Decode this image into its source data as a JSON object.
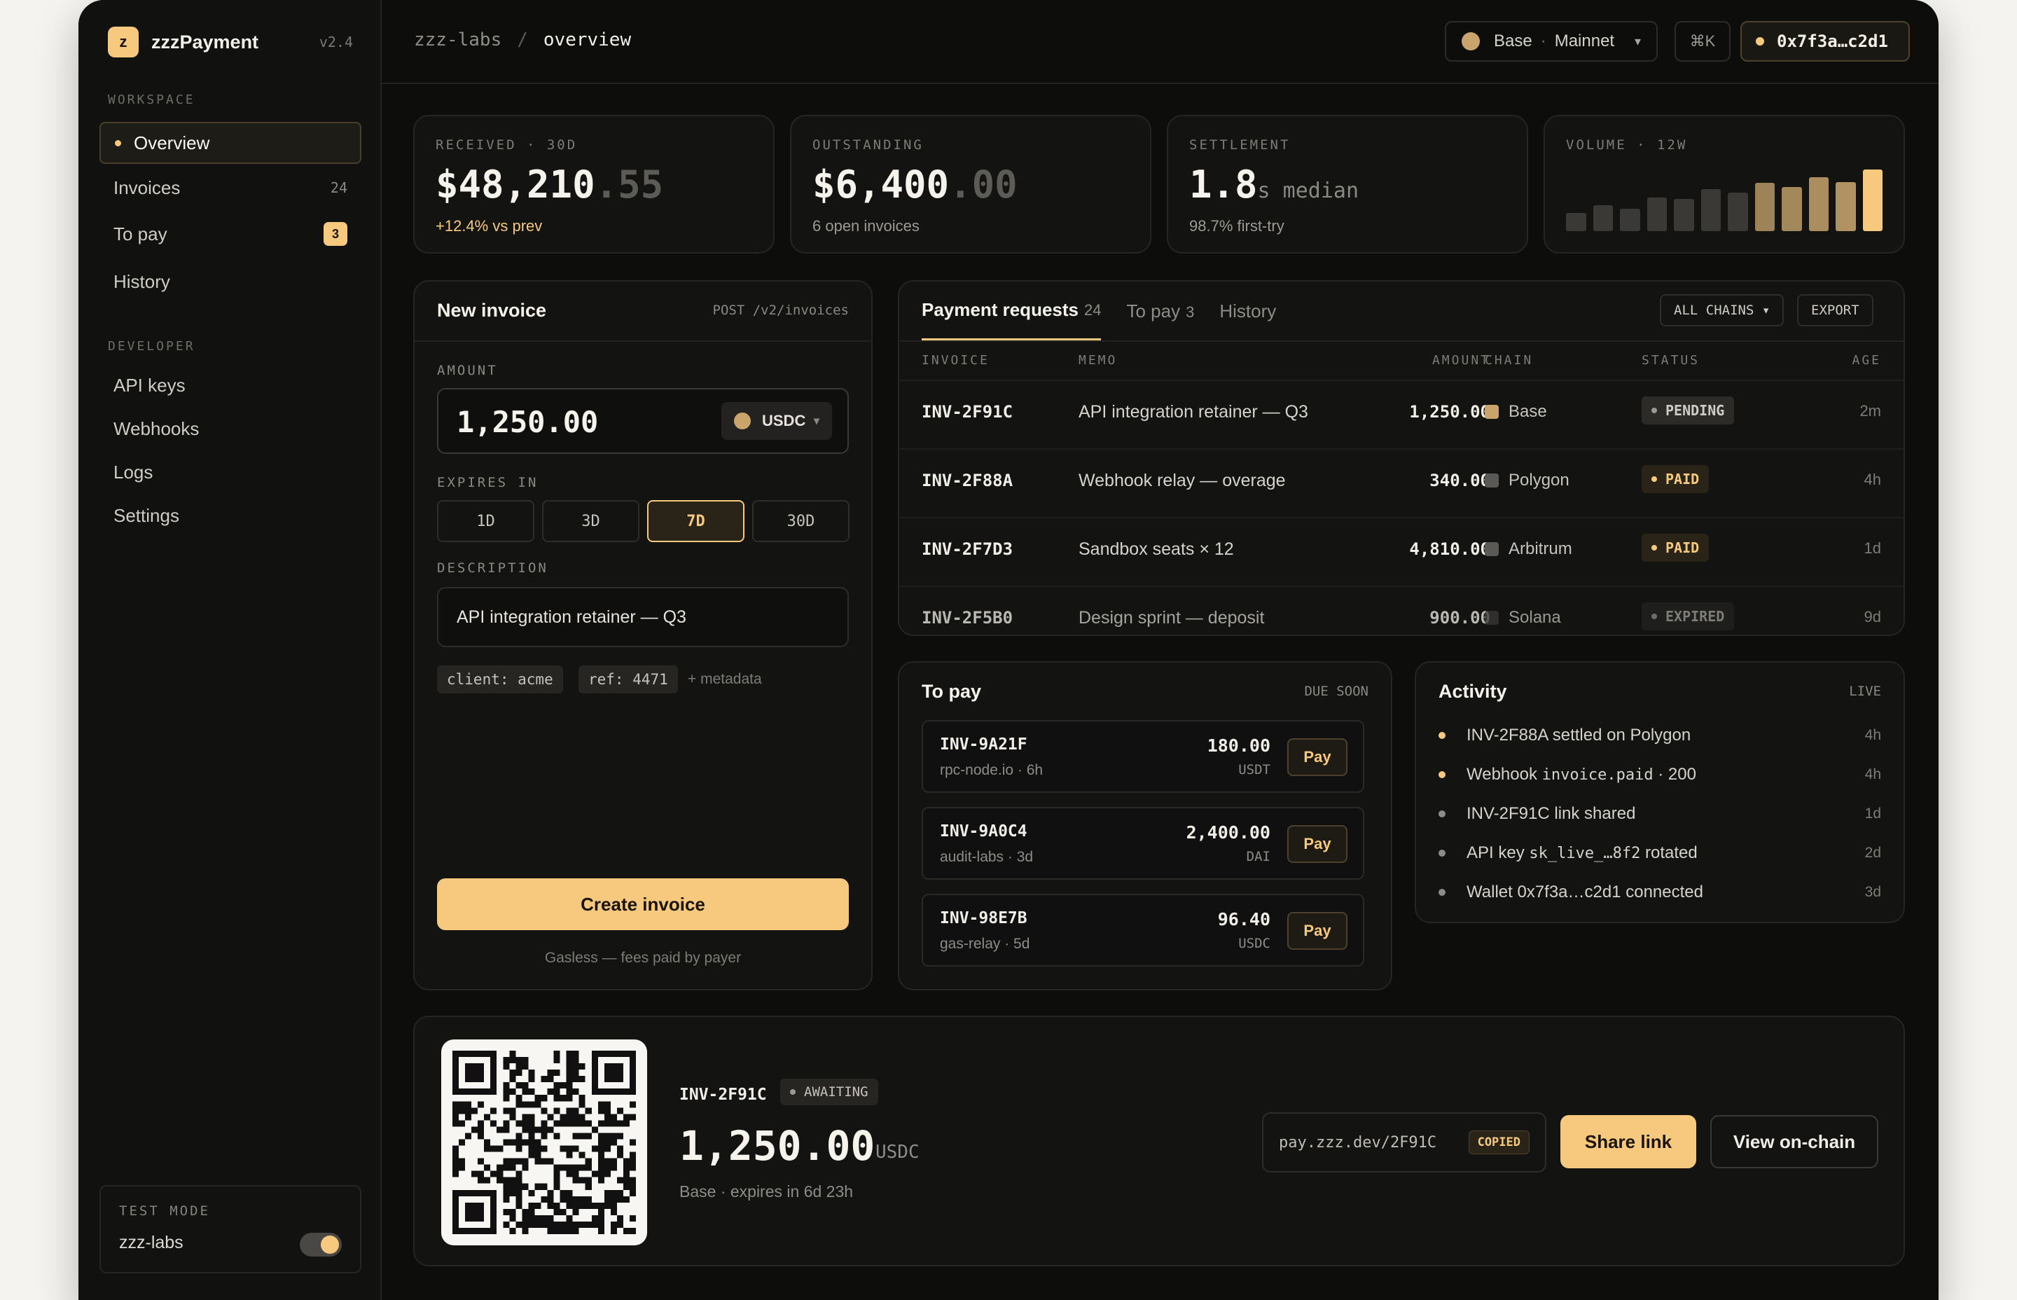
{
  "app": {
    "logo_letter": "z",
    "name": "zzzPayment",
    "version": "v2.4"
  },
  "sidebar": {
    "workspace_label": "WORKSPACE",
    "workspace_items": [
      {
        "label": "Overview",
        "active": true
      },
      {
        "label": "Invoices",
        "count": "24"
      },
      {
        "label": "To pay",
        "badge": "3"
      },
      {
        "label": "History"
      }
    ],
    "developer_label": "DEVELOPER",
    "developer_items": [
      {
        "label": "API keys"
      },
      {
        "label": "Webhooks"
      },
      {
        "label": "Logs"
      },
      {
        "label": "Settings"
      }
    ],
    "test_mode": {
      "label": "TEST MODE",
      "workspace": "zzz-labs",
      "enabled": true
    }
  },
  "topbar": {
    "breadcrumb": {
      "org": "zzz-labs",
      "sep": "/",
      "page": "overview"
    },
    "network": {
      "chain": "Base",
      "dot": "·",
      "env": "Mainnet",
      "caret": "▾"
    },
    "shortcut": "⌘K",
    "wallet": "0x7f3a…c2d1"
  },
  "stats": [
    {
      "label": "RECEIVED · 30D",
      "value_main": "$48,210",
      "value_dim": ".55",
      "sub": "+12.4% vs prev"
    },
    {
      "label": "OUTSTANDING",
      "value_main": "$6,400",
      "value_dim": ".00",
      "sub": "6 open invoices"
    },
    {
      "label": "SETTLEMENT",
      "value_main": "1.8",
      "value_small": "s median",
      "sub": "98.7% first-try"
    },
    {
      "label": "VOLUME · 12W",
      "bars": [
        0.3,
        0.42,
        0.36,
        0.55,
        0.52,
        0.68,
        0.62,
        0.78,
        0.72,
        0.88,
        0.8,
        1.0
      ]
    }
  ],
  "new_invoice": {
    "title": "New invoice",
    "endpoint": "POST /v2/invoices",
    "amount_label": "AMOUNT",
    "amount": "1,250.00",
    "currency": "USDC",
    "currency_caret": "▾",
    "expires_label": "EXPIRES IN",
    "expires_options": [
      "1D",
      "3D",
      "7D",
      "30D"
    ],
    "expires_selected": "7D",
    "description_label": "DESCRIPTION",
    "description": "API integration retainer — Q3",
    "tags": [
      "client: acme",
      "ref: 4471"
    ],
    "metadata_link": "+ metadata",
    "create_label": "Create invoice",
    "footnote": "Gasless — fees paid by payer"
  },
  "requests": {
    "tabs": [
      {
        "label": "Payment requests",
        "count": "24",
        "active": true
      },
      {
        "label": "To pay",
        "count": "3"
      },
      {
        "label": "History"
      }
    ],
    "filter_label": "ALL CHAINS ▾",
    "export_label": "EXPORT",
    "columns": {
      "invoice": "INVOICE",
      "memo": "MEMO",
      "amount": "AMOUNT",
      "chain": "CHAIN",
      "status": "STATUS",
      "age": "AGE"
    },
    "rows": [
      {
        "invoice": "INV-2F91C",
        "memo": "API integration retainer — Q3",
        "amount": "1,250.00",
        "chain": "Base",
        "chain_color": "#c9a56b",
        "status": "PENDING",
        "age": "2m"
      },
      {
        "invoice": "INV-2F88A",
        "memo": "Webhook relay — overage",
        "amount": "340.00",
        "chain": "Polygon",
        "chain_color": "#5a5955",
        "status": "PAID",
        "age": "4h"
      },
      {
        "invoice": "INV-2F7D3",
        "memo": "Sandbox seats × 12",
        "amount": "4,810.00",
        "chain": "Arbitrum",
        "chain_color": "#5a5955",
        "status": "PAID",
        "age": "1d"
      },
      {
        "invoice": "INV-2F5B0",
        "memo": "Design sprint — deposit",
        "amount": "900.00",
        "chain": "Solana",
        "chain_color": "#3a3936",
        "status": "EXPIRED",
        "age": "9d"
      }
    ]
  },
  "to_pay": {
    "title": "To pay",
    "tag": "DUE SOON",
    "items": [
      {
        "id": "INV-9A21F",
        "from": "rpc-node.io · 6h",
        "amount": "180.00",
        "token": "USDT",
        "action": "Pay"
      },
      {
        "id": "INV-9A0C4",
        "from": "audit-labs · 3d",
        "amount": "2,400.00",
        "token": "DAI",
        "action": "Pay"
      },
      {
        "id": "INV-98E7B",
        "from": "gas-relay · 5d",
        "amount": "96.40",
        "token": "USDC",
        "action": "Pay"
      }
    ]
  },
  "activity": {
    "title": "Activity",
    "tag": "LIVE",
    "items": [
      {
        "pre": "INV-2F88A settled on Polygon",
        "code": "",
        "post": "",
        "time": "4h",
        "highlight": true
      },
      {
        "pre": "Webhook ",
        "code": "invoice.paid",
        "post": " · 200",
        "time": "4h",
        "highlight": true
      },
      {
        "pre": "INV-2F91C link shared",
        "code": "",
        "post": "",
        "time": "1d",
        "highlight": false
      },
      {
        "pre": "API key ",
        "code": "sk_live_…8f2",
        "post": " rotated",
        "time": "2d",
        "highlight": false
      },
      {
        "pre": "Wallet 0x7f3a…c2d1 connected",
        "code": "",
        "post": "",
        "time": "3d",
        "highlight": false
      }
    ]
  },
  "share": {
    "invoice": "INV-2F91C",
    "status": "AWAITING",
    "amount": "1,250.00",
    "currency": "USDC",
    "subtitle": "Base · expires in 6d 23h",
    "link": "pay.zzz.dev/2F91C",
    "copied_label": "COPIED",
    "share_label": "Share link",
    "view_label": "View on-chain"
  },
  "colors": {
    "accent": "#f6c97f",
    "bg": "#0d0d0c",
    "panel": "#131312"
  }
}
